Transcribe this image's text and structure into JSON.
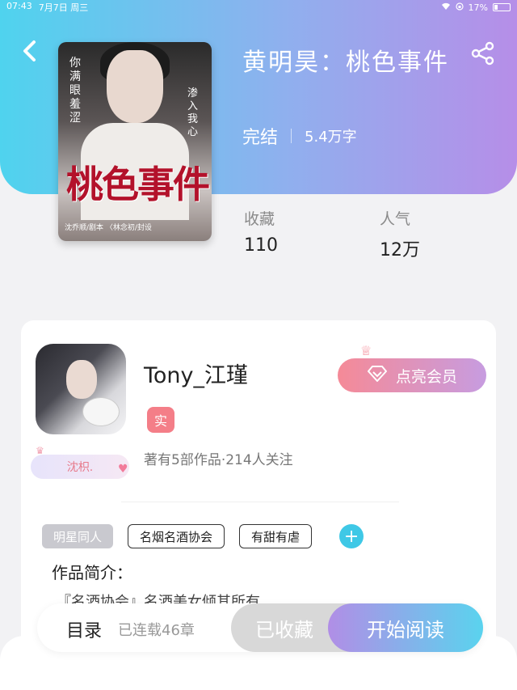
{
  "status_bar": {
    "time": "07:43",
    "date": "7月7日 周三",
    "battery": "17%"
  },
  "book": {
    "title": "黄明昊：桃色事件",
    "status": "完结",
    "word_count": "5.4万字",
    "cover": {
      "title_art": "桃色事件",
      "side_left": "你满眼羞涩",
      "side_right": "渗入我心",
      "credits": "沈乔顺/剧本  〈林念初/封设"
    }
  },
  "stats": [
    {
      "label": "收藏",
      "value": "110"
    },
    {
      "label": "人气",
      "value": "12万"
    }
  ],
  "author": {
    "name": "Tony_江瑾",
    "badge": "实",
    "info": "著有5部作品·214人关注",
    "tag": "沈枳."
  },
  "vip_button": {
    "label": "点亮会员"
  },
  "tags": [
    "明星同人",
    "名烟名酒协会",
    "有甜有虐"
  ],
  "tag_add": "+",
  "intro": {
    "title": "作品简介：",
    "text": "『名酒协会』名酒美女倾其所有"
  },
  "bottom_bar": {
    "toc": "目录",
    "serial": "已连载46章",
    "collected": "已收藏",
    "read": "开始阅读"
  },
  "colors": {
    "header_start": "#4fd3ee",
    "header_end": "#b68ee8",
    "vip_start": "#f58a97",
    "vip_end": "#c79ce0",
    "read_start": "#b18ee6",
    "read_end": "#5ad3ee",
    "accent_blue": "#3fc8e6"
  },
  "icons": {
    "back": "chevron-left-icon",
    "share": "share-icon",
    "vip": "diamond-icon",
    "add": "plus-icon"
  }
}
